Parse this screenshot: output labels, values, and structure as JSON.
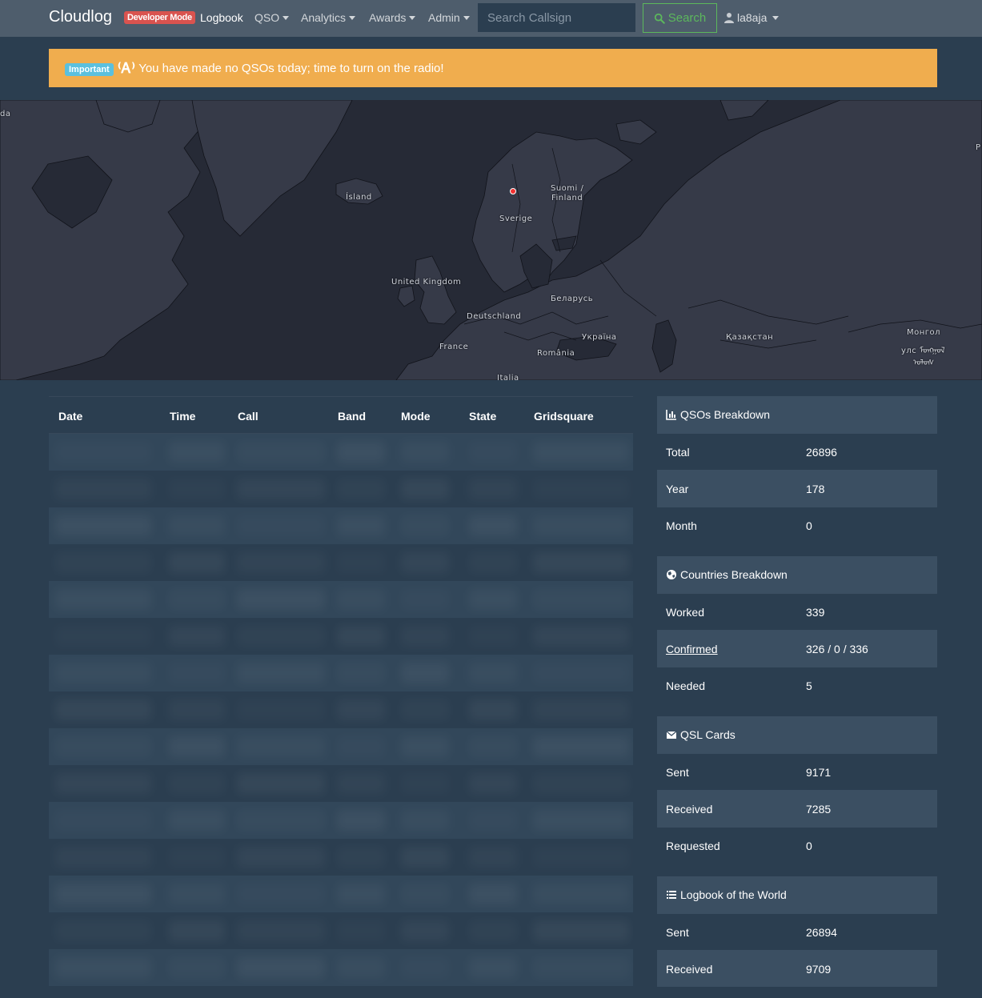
{
  "navbar": {
    "brand": "Cloudlog",
    "dev_badge": "Developer Mode",
    "items": [
      {
        "label": "Logbook"
      },
      {
        "label": "QSO"
      },
      {
        "label": "Analytics"
      },
      {
        "label": "Awards"
      },
      {
        "label": "Admin"
      }
    ],
    "search_placeholder": "Search Callsign",
    "search_button": "Search",
    "user": "la8aja"
  },
  "alert": {
    "badge": "Important",
    "icon": "radio-tower-icon",
    "message": "You have made no QSOs today; time to turn on the radio!"
  },
  "map": {
    "labels": [
      "Ísland",
      "Suomi /",
      "Finland",
      "Sverige",
      "United Kingdom",
      "Беларусь",
      "Deutschland",
      "Україна",
      "France",
      "România",
      "Italia",
      "Қазақстан",
      "Монгол",
      "улс ᠮᠤᠩᠭᠤᠯ",
      "ᠤᠯᠤᠰ",
      "da",
      "P"
    ]
  },
  "qso_table": {
    "columns": [
      "Date",
      "Time",
      "Call",
      "Band",
      "Mode",
      "State",
      "Gridsquare"
    ]
  },
  "panels": [
    {
      "title": "QSOs Breakdown",
      "icon": "chart-icon",
      "rows": [
        {
          "key": "Total",
          "value": "26896"
        },
        {
          "key": "Year",
          "value": "178"
        },
        {
          "key": "Month",
          "value": "0"
        }
      ]
    },
    {
      "title": "Countries Breakdown",
      "icon": "globe-icon",
      "rows": [
        {
          "key": "Worked",
          "value": "339"
        },
        {
          "key": "Confirmed",
          "value": "326 / 0 / 336"
        },
        {
          "key": "Needed",
          "value": "5"
        }
      ]
    },
    {
      "title": "QSL Cards",
      "icon": "envelope-icon",
      "rows": [
        {
          "key": "Sent",
          "value": "9171"
        },
        {
          "key": "Received",
          "value": "7285"
        },
        {
          "key": "Requested",
          "value": "0"
        }
      ]
    },
    {
      "title": "Logbook of the World",
      "icon": "list-icon",
      "rows": [
        {
          "key": "Sent",
          "value": "26894"
        },
        {
          "key": "Received",
          "value": "9709"
        }
      ]
    }
  ],
  "colors": {
    "navbar": "#4e5d6c",
    "background": "#2b3e50",
    "alert": "#f0ad4e",
    "dev_badge": "#d9534f",
    "search_button": "#5cb85c",
    "important_badge": "#5bc0de"
  }
}
